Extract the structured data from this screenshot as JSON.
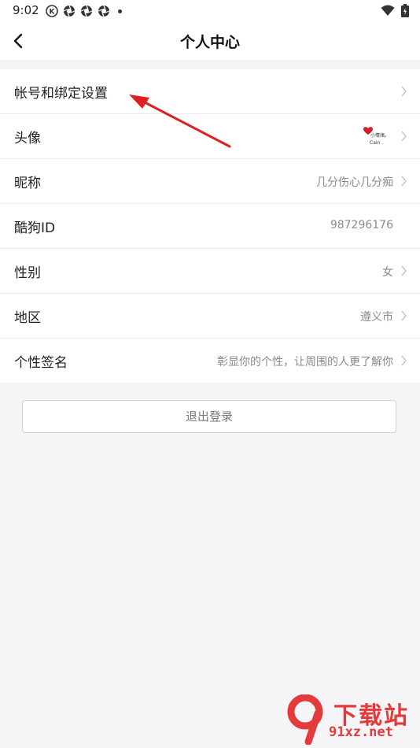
{
  "status": {
    "time": "9:02",
    "icons": [
      "k-icon",
      "aperture-icon",
      "aperture-icon",
      "aperture-icon",
      "dot-icon"
    ],
    "right_icons": [
      "wifi-icon",
      "battery-icon"
    ]
  },
  "nav": {
    "title": "个人中心",
    "back_icon": "chevron-left-icon"
  },
  "rows": [
    {
      "label": "帐号和绑定设置",
      "value": "",
      "arrow": true
    },
    {
      "label": "头像",
      "value": "",
      "avatar_text_1": "小情绪。",
      "avatar_text_2": "Cain .",
      "arrow": true
    },
    {
      "label": "昵称",
      "value": "几分伤心几分痴",
      "arrow": true
    },
    {
      "label": "酷狗ID",
      "value": "987296176",
      "arrow": false
    },
    {
      "label": "性别",
      "value": "女",
      "arrow": true
    },
    {
      "label": "地区",
      "value": "遵义市",
      "arrow": true
    },
    {
      "label": "个性签名",
      "value": "彰显你的个性，让周围的人更了解你",
      "arrow": true
    }
  ],
  "logout": {
    "label": "退出登录"
  },
  "watermark": {
    "main": "下载站",
    "sub": "91xz.net",
    "logo": "9"
  },
  "colors": {
    "annotation_arrow": "#e02020",
    "watermark": "#e33b3b"
  }
}
